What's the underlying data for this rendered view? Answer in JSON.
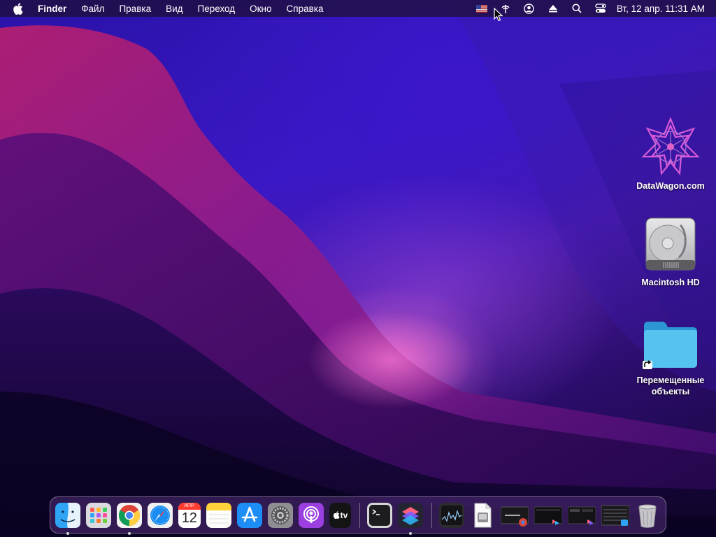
{
  "menubar": {
    "app_name": "Finder",
    "menus": [
      "Файл",
      "Правка",
      "Вид",
      "Переход",
      "Окно",
      "Справка"
    ],
    "clock": "Вт, 12 апр.  11:31 AM",
    "status_icons": [
      "us-flag-icon",
      "antenna-icon",
      "user-circle-icon",
      "eject-icon",
      "search-icon",
      "control-center-icon"
    ]
  },
  "desktop": {
    "icons": [
      {
        "label": "DataWagon.com",
        "icon": "datawagon-logo-icon"
      },
      {
        "label": "Macintosh HD",
        "icon": "hard-drive-icon"
      },
      {
        "label": "Перемещенные объекты",
        "icon": "folder-alias-icon"
      }
    ]
  },
  "dock": {
    "calendar_month": "АПР.",
    "calendar_day": "12",
    "tv_label": "tv",
    "apps": [
      "finder",
      "launchpad",
      "chrome",
      "safari",
      "calendar",
      "notes",
      "app-store",
      "system-preferences",
      "podcasts",
      "apple-tv",
      "terminal",
      "shortcuts",
      "activity-monitor",
      "preview",
      "window-1",
      "window-2",
      "window-3",
      "window-4",
      "trash"
    ]
  },
  "colors": {
    "menubar_bg": "#1c0e30",
    "folder_blue": "#3fb3ec",
    "wallpaper_accent": "#e054c8"
  }
}
